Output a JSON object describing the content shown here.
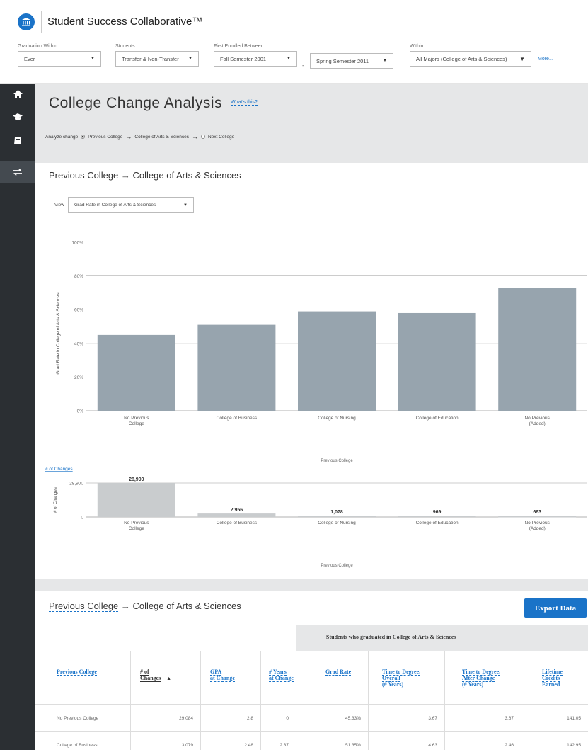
{
  "app": {
    "title": "Student Success Collaborative™"
  },
  "filters": {
    "graduation": {
      "label": "Graduation Within:",
      "value": "Ever"
    },
    "students": {
      "label": "Students:",
      "value": "Transfer & Non-Transfer"
    },
    "enrolled": {
      "label": "First Enrolled Between:",
      "from": "Fall Semester 2001",
      "dash": "-",
      "to": "Spring Semester 2011"
    },
    "within": {
      "label": "Within:",
      "value": "All Majors (College of Arts & Sciences)"
    },
    "more": "More..."
  },
  "sidebar": {
    "icons": [
      "home-icon",
      "graduation-cap-icon",
      "book-icon",
      "transfer-arrows-icon"
    ],
    "active": "transfer-arrows-icon"
  },
  "page": {
    "title": "College Change Analysis",
    "whats_this": "What's this?",
    "analyze": {
      "label": "Analyze change",
      "option_previous": "Previous College",
      "middle": "College of Arts & Sciences",
      "option_next": "Next College"
    }
  },
  "chart_section": {
    "heading_left": "Previous College",
    "heading_right": "College of Arts & Sciences",
    "view_label": "View",
    "view_value": "Grad Rate in College of Arts & Sciences"
  },
  "chart_data": [
    {
      "type": "bar",
      "categories": [
        "No Previous College",
        "College of Business",
        "College of Nursing",
        "College of Education",
        "No Previous (Added)"
      ],
      "values": [
        45,
        51,
        59,
        58,
        73
      ],
      "ylabel": "Grad Rate in College of Arts & Sciences",
      "xlabel": "Previous College",
      "yticks": [
        "0%",
        "20%",
        "40%",
        "60%",
        "80%",
        "100%"
      ],
      "ylim": [
        0,
        100
      ],
      "color": "#97a4ae",
      "grid": true
    },
    {
      "type": "bar",
      "title": "# of Changes",
      "categories": [
        "No Previous College",
        "College of Business",
        "College of Nursing",
        "College of Education",
        "No Previous (Added)"
      ],
      "values": [
        28900,
        2956,
        1078,
        969,
        663
      ],
      "value_labels": [
        "28,900",
        "2,956",
        "1,078",
        "969",
        "663"
      ],
      "ylabel": "# of Changes",
      "xlabel": "Previous College",
      "yticks": [
        "0",
        "28,900"
      ],
      "ylim": [
        0,
        28900
      ],
      "color": "#c9ccce"
    }
  ],
  "table_section": {
    "heading_left": "Previous College",
    "heading_right": "College of Arts & Sciences",
    "export_label": "Export Data",
    "group_header": "Students who graduated in College of Arts & Sciences",
    "columns": [
      [
        "Previous College"
      ],
      [
        "# of",
        "Changes"
      ],
      [
        "GPA",
        "at Change"
      ],
      [
        "# Years",
        "at Change"
      ],
      [
        "Grad Rate"
      ],
      [
        "Time to Degree,",
        "Overall",
        "(# Years)"
      ],
      [
        "Time to Degree,",
        "After Change",
        "(# Years)"
      ],
      [
        "Lifetime",
        "Credits",
        "Earned"
      ]
    ],
    "sort_indicator": "▲",
    "rows": [
      [
        "No Previous College",
        "29,084",
        "2.8",
        "0",
        "45.33%",
        "3.67",
        "3.67",
        "141.05"
      ],
      [
        "College of Business",
        "3,079",
        "2.48",
        "2.37",
        "51.35%",
        "4.63",
        "2.46",
        "142.95"
      ]
    ]
  }
}
